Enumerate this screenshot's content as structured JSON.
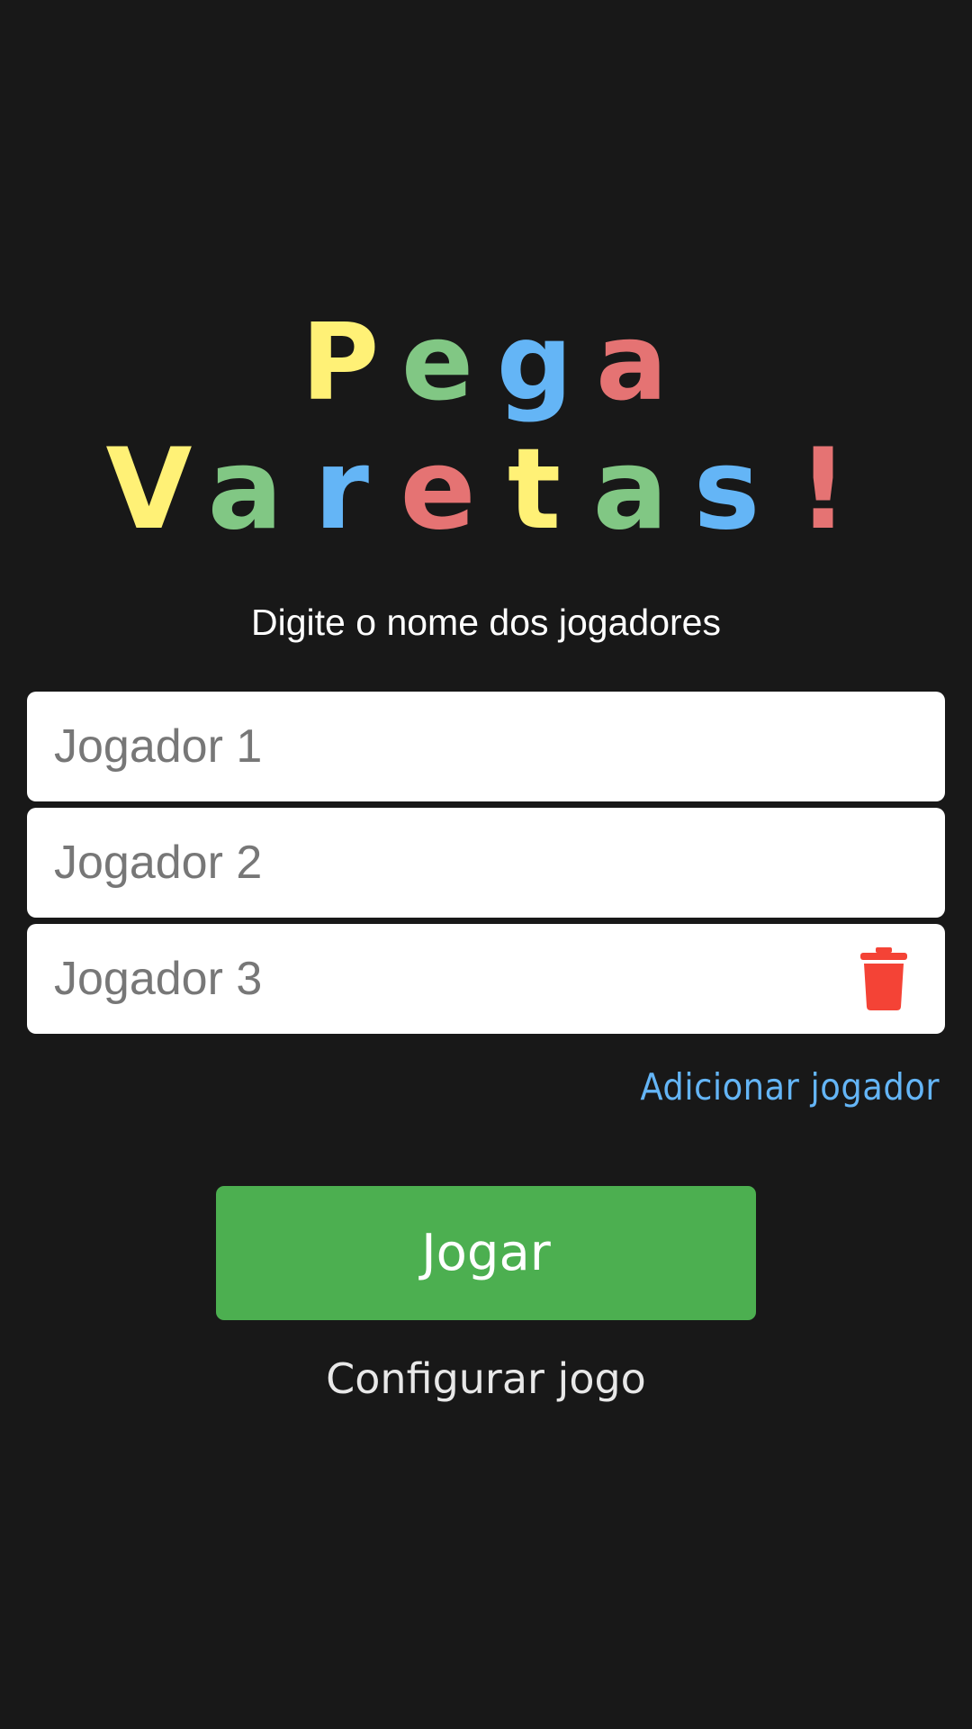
{
  "title": {
    "line1": [
      {
        "char": "P",
        "color": "#fff176"
      },
      {
        "char": "e",
        "color": "#81c784"
      },
      {
        "char": "g",
        "color": "#64b5f6"
      },
      {
        "char": "a",
        "color": "#e57373"
      }
    ],
    "line2": [
      {
        "char": "V",
        "color": "#fff176"
      },
      {
        "char": "a",
        "color": "#81c784"
      },
      {
        "char": "r",
        "color": "#64b5f6"
      },
      {
        "char": "e",
        "color": "#e57373"
      },
      {
        "char": "t",
        "color": "#fff176"
      },
      {
        "char": "a",
        "color": "#81c784"
      },
      {
        "char": "s",
        "color": "#64b5f6"
      },
      {
        "char": "!",
        "color": "#e57373"
      }
    ]
  },
  "subtitle": "Digite o nome dos jogadores",
  "players": [
    {
      "placeholder": "Jogador 1",
      "value": ""
    },
    {
      "placeholder": "Jogador 2",
      "value": ""
    },
    {
      "placeholder": "Jogador 3",
      "value": "",
      "remove_icon": "trash-icon"
    }
  ],
  "add_player_label": "Adicionar jogador",
  "play_label": "Jogar",
  "configure_label": "Configurar jogo",
  "colors": {
    "background": "#181818",
    "accent_green": "#4caf50",
    "link_blue": "#64b5f6",
    "trash_red": "#f44336"
  }
}
